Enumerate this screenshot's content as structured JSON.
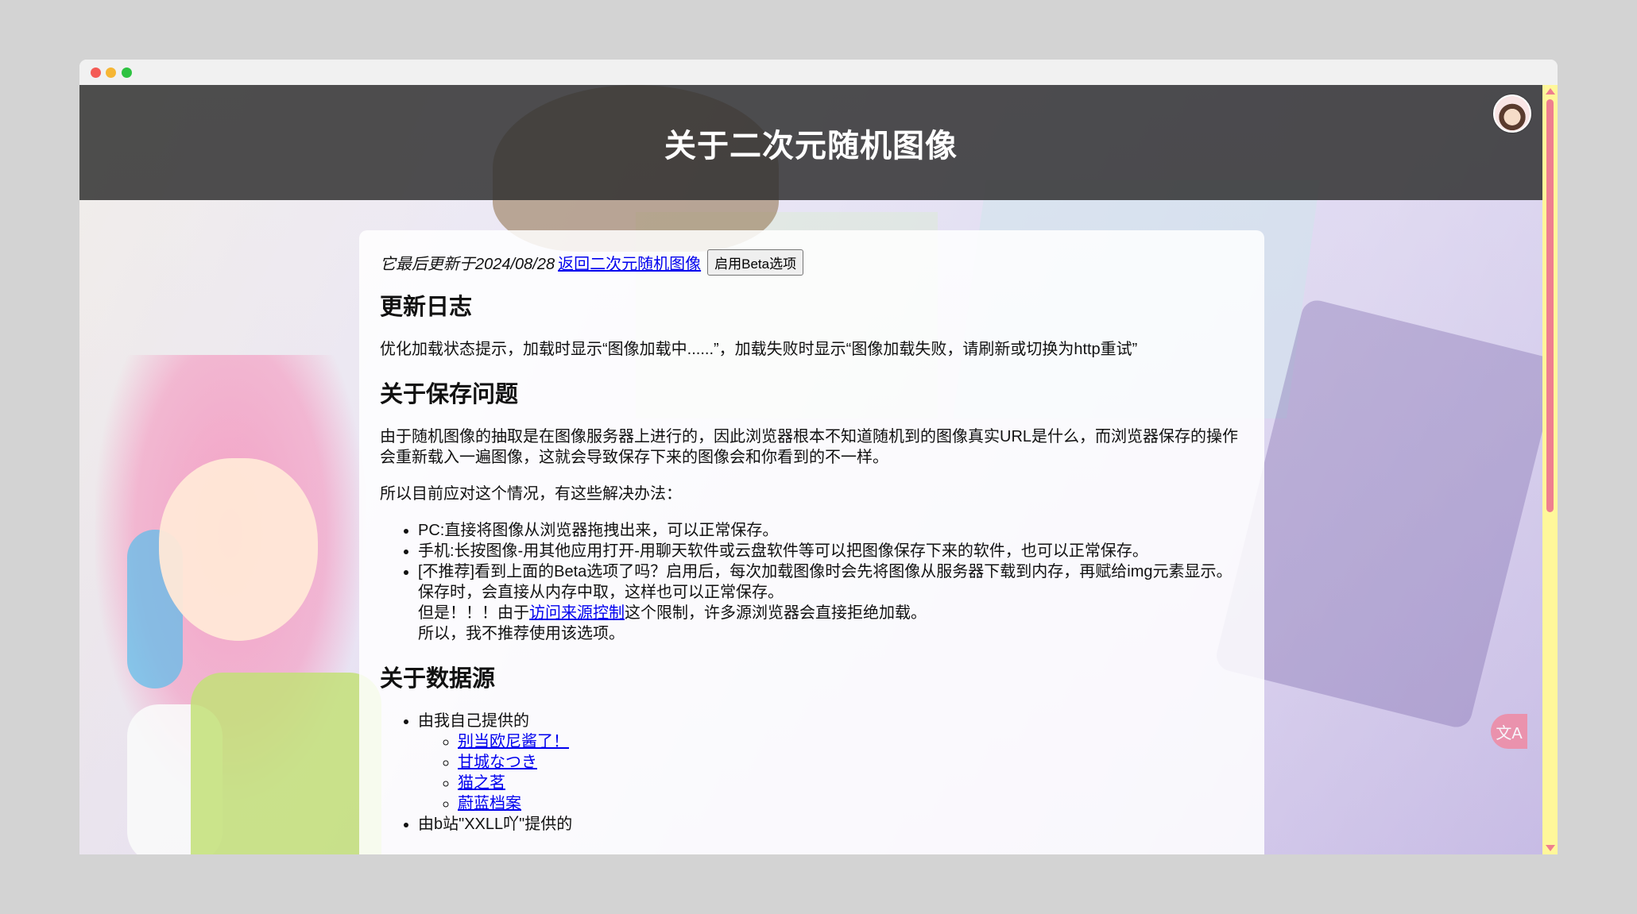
{
  "header": {
    "title": "关于二次元随机图像"
  },
  "meta": {
    "updated": "它最后更新于2024/08/28",
    "back_link": "返回二次元随机图像",
    "beta_button": "启用Beta选项"
  },
  "changelog": {
    "heading": "更新日志",
    "text": "优化加载状态提示，加载时显示“图像加载中......”，加载失败时显示“图像加载失败，请刷新或切换为http重试”"
  },
  "saving": {
    "heading": "关于保存问题",
    "para1": "由于随机图像的抽取是在图像服务器上进行的，因此浏览器根本不知道随机到的图像真实URL是什么，而浏览器保存的操作会重新载入一遍图像，这就会导致保存下来的图像会和你看到的不一样。",
    "para2": "所以目前应对这个情况，有这些解决办法：",
    "items": [
      "PC:直接将图像从浏览器拖拽出来，可以正常保存。",
      "手机:长按图像-用其他应用打开-用聊天软件或云盘软件等可以把图像保存下来的软件，也可以正常保存。"
    ],
    "item3": {
      "line1": "[不推荐]看到上面的Beta选项了吗？启用后，每次加载图像时会先将图像从服务器下载到内存，再赋给img元素显示。",
      "line2": "保存时，会直接从内存中取，这样也可以正常保存。",
      "line3_before": "但是！！！由于",
      "line3_link": "访问来源控制",
      "line3_after": "这个限制，许多源浏览器会直接拒绝加载。",
      "line4": "所以，我不推荐使用该选项。"
    }
  },
  "sources": {
    "heading": "关于数据源",
    "group1": {
      "label": "由我自己提供的",
      "links": [
        "别当欧尼酱了！",
        "甘城なつき",
        "猫之茗",
        "蔚蓝档案"
      ]
    },
    "group2": {
      "label": "由b站\"XXLL吖\"提供的"
    }
  },
  "ui": {
    "translate_icon": "文A"
  },
  "colors": {
    "header_bg": "#303030",
    "link": "#0000ee",
    "scrollbar_track": "#fff79a",
    "scrollbar_thumb": "#ef7f8f"
  }
}
